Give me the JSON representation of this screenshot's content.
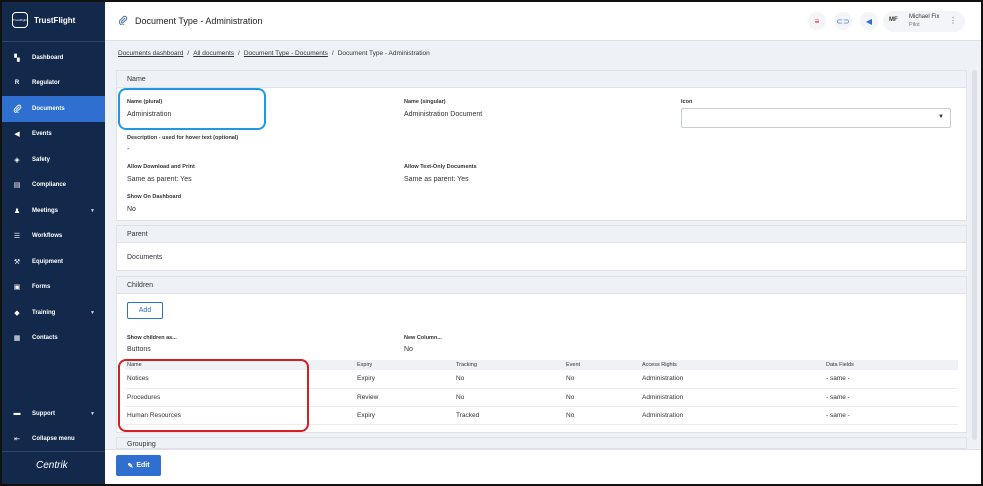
{
  "app": {
    "brand_name": "TrustFlight",
    "brand_logo_text": "TrustFlight",
    "footer_logo": "Centrik"
  },
  "header": {
    "title": "Document Type - Administration",
    "user": {
      "initials": "MF",
      "name": "Michael Fix",
      "role": "Pilot"
    }
  },
  "sidebar": {
    "items": [
      {
        "label": "Dashboard",
        "icon": "dashboard-icon",
        "glyph": "▚"
      },
      {
        "label": "Regulator",
        "icon": "regulator-icon",
        "glyph": "R"
      },
      {
        "label": "Documents",
        "icon": "paperclip-icon",
        "glyph": "⌀"
      },
      {
        "label": "Events",
        "icon": "megaphone-icon",
        "glyph": "◀"
      },
      {
        "label": "Safety",
        "icon": "shield-icon",
        "glyph": "◈"
      },
      {
        "label": "Compliance",
        "icon": "clipboard-icon",
        "glyph": "▤"
      },
      {
        "label": "Meetings",
        "icon": "meetings-icon",
        "glyph": "♟"
      },
      {
        "label": "Workflows",
        "icon": "workflows-icon",
        "glyph": "☰"
      },
      {
        "label": "Equipment",
        "icon": "wrench-icon",
        "glyph": "⚒"
      },
      {
        "label": "Forms",
        "icon": "forms-icon",
        "glyph": "▣"
      },
      {
        "label": "Training",
        "icon": "graduation-cap-icon",
        "glyph": "◆"
      },
      {
        "label": "Contacts",
        "icon": "contacts-icon",
        "glyph": "▦"
      }
    ],
    "support_label": "Support",
    "collapse_label": "Collapse menu"
  },
  "breadcrumb": {
    "items": [
      "Documents dashboard",
      "All documents",
      "Document Type - Documents",
      "Document Type - Administration"
    ]
  },
  "name_section": {
    "title": "Name",
    "plural_label": "Name (plural)",
    "plural_value": "Administration",
    "singular_label": "Name (singular)",
    "singular_value": "Administration Document",
    "icon_label": "Icon",
    "description_label": "Description - used for hover text (optional)",
    "description_value": "-",
    "download_label": "Allow Download and Print",
    "download_value": "Same as parent: Yes",
    "textonly_label": "Allow Text-Only Documents",
    "textonly_value": "Same as parent: Yes",
    "dashboard_label": "Show On Dashboard",
    "dashboard_value": "No"
  },
  "parent_section": {
    "title": "Parent",
    "value": "Documents"
  },
  "children_section": {
    "title": "Children",
    "add_label": "Add",
    "show_as_label": "Show children as...",
    "show_as_value": "Buttons",
    "new_column_label": "New Column...",
    "new_column_value": "No",
    "columns": [
      "Name",
      "Expiry",
      "Tracking",
      "Event",
      "Access Rights",
      "Data Fields"
    ],
    "rows": [
      [
        "Notices",
        "Expiry",
        "No",
        "No",
        "Administration",
        "- same -"
      ],
      [
        "Procedures",
        "Review",
        "No",
        "No",
        "Administration",
        "- same -"
      ],
      [
        "Human Resources",
        "Expiry",
        "Tracked",
        "No",
        "Administration",
        "- same -"
      ]
    ]
  },
  "grouping_section": {
    "title": "Grouping"
  },
  "edit_label": "Edit",
  "colors": {
    "sidebar_bg": "#13294b",
    "accent": "#2f6fd0",
    "highlight_blue": "#1e9be0",
    "highlight_red": "#d42020"
  }
}
